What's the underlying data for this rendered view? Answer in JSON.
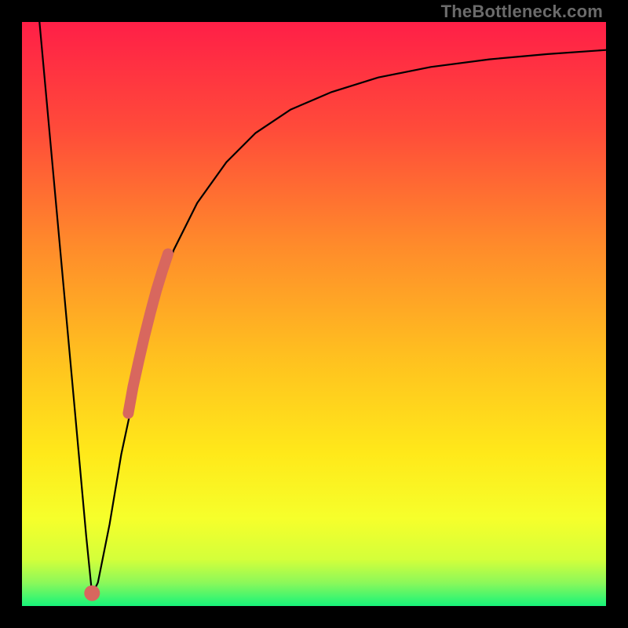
{
  "watermark": "TheBottleneck.com",
  "chart_data": {
    "type": "line",
    "title": "",
    "xlabel": "",
    "ylabel": "",
    "xlim": [
      0,
      100
    ],
    "ylim": [
      0,
      100
    ],
    "grid": false,
    "legend": false,
    "background_gradient": {
      "top_color": "#ff1f47",
      "mid_colors": [
        "#ff7a2b",
        "#ffd31a",
        "#f7ff2a"
      ],
      "bottom_color": "#17f47a"
    },
    "series": [
      {
        "name": "bottleneck-curve",
        "type": "line",
        "color": "#000000",
        "x": [
          3,
          5,
          7,
          9,
          11,
          12,
          13,
          15,
          17,
          20,
          23,
          26,
          30,
          35,
          40,
          46,
          53,
          61,
          70,
          80,
          90,
          100
        ],
        "y": [
          100,
          78,
          56,
          34,
          12,
          2,
          4,
          14,
          26,
          40,
          52,
          61,
          69,
          76,
          81,
          85,
          88,
          90.5,
          92.3,
          93.6,
          94.5,
          95.2
        ]
      },
      {
        "name": "highlight-segment",
        "type": "line",
        "color": "#d8675e",
        "thick": true,
        "x": [
          18.2,
          19.0,
          20.0,
          21.0,
          22.0,
          23.0,
          24.0,
          25.0
        ],
        "y": [
          33.0,
          37.5,
          42.0,
          46.3,
          50.3,
          54.0,
          57.3,
          60.3
        ]
      },
      {
        "name": "highlight-dot",
        "type": "scatter",
        "color": "#d8675e",
        "x": [
          12.0
        ],
        "y": [
          2.2
        ]
      }
    ]
  }
}
